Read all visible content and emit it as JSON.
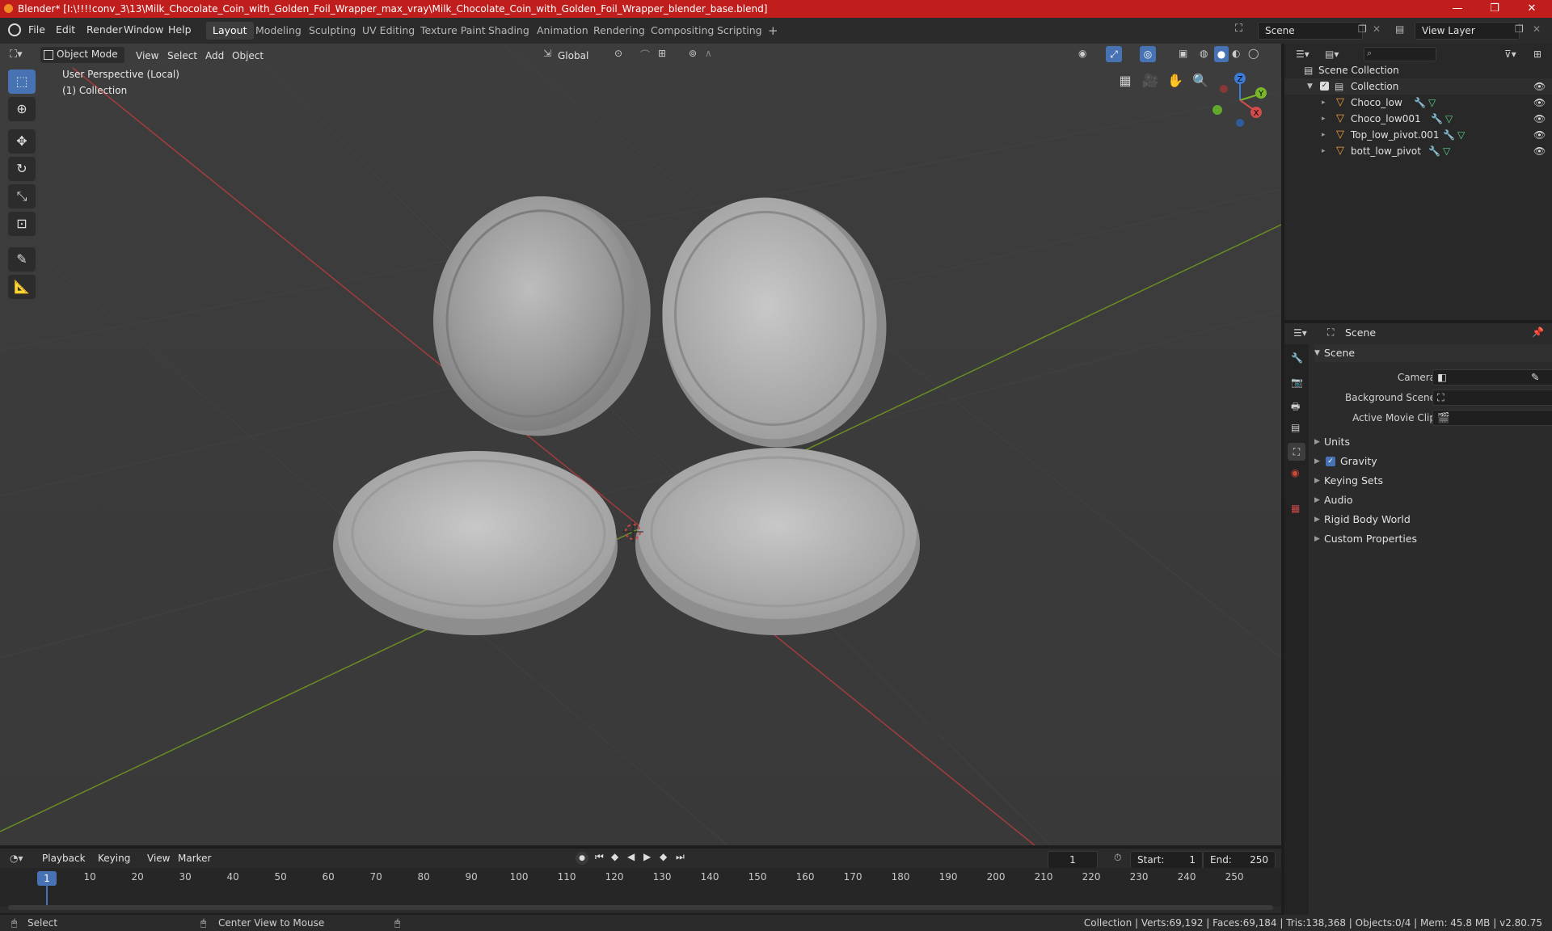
{
  "title_bar": {
    "title": "Blender* [I:\\!!!!conv_3\\13\\Milk_Chocolate_Coin_with_Golden_Foil_Wrapper_max_vray\\Milk_Chocolate_Coin_with_Golden_Foil_Wrapper_blender_base.blend]",
    "minimize": "—",
    "maximize": "❐",
    "close": "✕"
  },
  "menu": {
    "items": [
      "File",
      "Edit",
      "Render",
      "Window",
      "Help"
    ]
  },
  "workspaces": [
    "Layout",
    "Modeling",
    "Sculpting",
    "UV Editing",
    "Texture Paint",
    "Shading",
    "Animation",
    "Rendering",
    "Compositing",
    "Scripting"
  ],
  "add_workspace": "+",
  "scene_field": "Scene",
  "view_layer_field": "View Layer",
  "viewport_header": {
    "mode": "Object Mode",
    "view": "View",
    "select": "Select",
    "add": "Add",
    "object": "Object",
    "orientation": "Global"
  },
  "viewport_overlay": {
    "perspective": "User Perspective (Local)",
    "collection": "(1) Collection"
  },
  "gizmo": {
    "x": "X",
    "y": "Y",
    "z": "Z"
  },
  "outliner": {
    "search_placeholder": "",
    "scene_collection": "Scene Collection",
    "collection": "Collection",
    "objects": [
      "Choco_low",
      "Choco_low001",
      "Top_low_pivot.001",
      "bott_low_pivot"
    ]
  },
  "properties": {
    "context": "Scene",
    "panel": "Scene",
    "camera_label": "Camera",
    "background_scene_label": "Background Scene",
    "active_movie_clip_label": "Active Movie Clip",
    "sections": [
      "Units",
      "Gravity",
      "Keying Sets",
      "Audio",
      "Rigid Body World",
      "Custom Properties"
    ],
    "gravity_checked": true
  },
  "timeline": {
    "playback": "Playback",
    "keying": "Keying",
    "view": "View",
    "marker": "Marker",
    "current_frame": "1",
    "start_label": "Start:",
    "start": "1",
    "end_label": "End:",
    "end": "250",
    "ticks": [
      "1",
      "10",
      "20",
      "30",
      "40",
      "50",
      "60",
      "70",
      "80",
      "90",
      "100",
      "110",
      "120",
      "130",
      "140",
      "150",
      "160",
      "170",
      "180",
      "190",
      "200",
      "210",
      "220",
      "230",
      "240",
      "250"
    ]
  },
  "status_bar": {
    "select": "Select",
    "center_view": "Center View to Mouse",
    "stats": "Collection | Verts:69,192 | Faces:69,184 | Tris:138,368 | Objects:0/4 | Mem: 45.8 MB | v2.80.75"
  },
  "colors": {
    "accent": "#4772b3",
    "titlebar": "#c01d1d",
    "x_axis": "#b03a3a",
    "y_axis": "#6a8e23"
  }
}
